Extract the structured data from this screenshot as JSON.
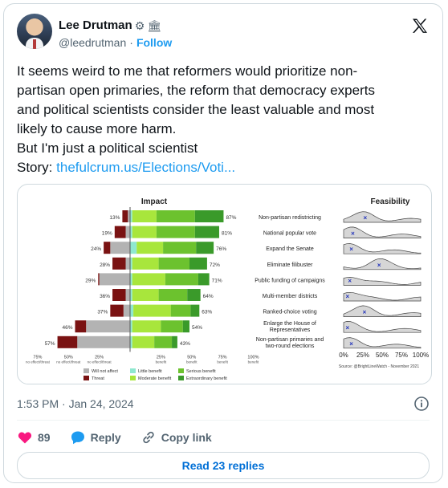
{
  "author": {
    "name": "Lee Drutman",
    "handle": "@leedrutman",
    "separator": "·",
    "follow_label": "Follow",
    "badge_icons": [
      "gear-icon",
      "government-icon"
    ]
  },
  "tweet": {
    "lines": [
      "It seems weird to me that reformers would prioritize non-",
      "partisan open primaries, the reform that democracy experts",
      "and political scientists consider the least valuable and most",
      "likely to cause more harm.",
      "But I'm just a political scientist"
    ],
    "story_label": "Story:",
    "story_link": "thefulcrum.us/Elections/Voti..."
  },
  "chart_data": {
    "type": "bar",
    "title_left": "Impact",
    "title_right": "Feasibility",
    "categories": [
      "Non-partisan redistricting",
      "National popular vote",
      "Expand the Senate",
      "Eliminate filibuster",
      "Public funding of campaigns",
      "Multi-member districts",
      "Ranked-choice voting",
      "Enlarge the House of Representatives",
      "Non-partisan primaries and two-round elections"
    ],
    "category_lines": [
      [
        "Non-partisan redistricting"
      ],
      [
        "National popular vote"
      ],
      [
        "Expand the Senate"
      ],
      [
        "Eliminate filibuster"
      ],
      [
        "Public funding of campaigns"
      ],
      [
        "Multi-member districts"
      ],
      [
        "Ranked-choice voting"
      ],
      [
        "Enlarge the House of",
        "Representatives"
      ],
      [
        "Non-partisan primaries and",
        "two-round elections"
      ]
    ],
    "negative_total_labels": [
      "13%",
      "19%",
      "24%",
      "28%",
      "29%",
      "36%",
      "37%",
      "46%",
      "57%"
    ],
    "positive_total_labels": [
      "87%",
      "81%",
      "76%",
      "72%",
      "71%",
      "64%",
      "63%",
      "54%",
      "43%"
    ],
    "series": [
      {
        "name": "Will not affect",
        "values": [
          2,
          4,
          18,
          4,
          28,
          4,
          6,
          40,
          48
        ]
      },
      {
        "name": "Threat",
        "values": [
          5,
          10,
          6,
          12,
          1,
          12,
          12,
          10,
          18
        ]
      },
      {
        "name": "Little benefit",
        "values": [
          2,
          2,
          6,
          2,
          2,
          2,
          3,
          2,
          2
        ]
      },
      {
        "name": "Moderate benefit",
        "values": [
          22,
          22,
          24,
          24,
          30,
          24,
          34,
          26,
          20
        ]
      },
      {
        "name": "Serious benefit",
        "values": [
          35,
          35,
          30,
          28,
          30,
          26,
          18,
          20,
          16
        ]
      },
      {
        "name": "Extraordinary benefit",
        "values": [
          26,
          22,
          16,
          16,
          10,
          12,
          8,
          6,
          5
        ]
      }
    ],
    "left_axis_ticks": [
      "75%",
      "50%",
      "25%"
    ],
    "left_axis_subticks": [
      "no effect/threat",
      "no effect/threat",
      "no effect/threat"
    ],
    "right_axis_ticks": [
      "25%",
      "50%",
      "75%",
      "100%"
    ],
    "right_axis_subticks": [
      "benefit",
      "benefit",
      "benefit",
      "benefit"
    ],
    "feasibility_ticks": [
      "0%",
      "25%",
      "50%",
      "75%",
      "100%"
    ],
    "feasibility_means": [
      0.28,
      0.12,
      0.1,
      0.46,
      0.08,
      0.05,
      0.27,
      0.05,
      0.1
    ],
    "source": "Source: @BrightLineWatch - November 2021",
    "colors": {
      "will_not_affect": "#b3b3b3",
      "threat": "#7a1212",
      "little_benefit": "#8fe8d0",
      "moderate_benefit": "#a8e63c",
      "serious_benefit": "#6cc22e",
      "extraordinary_benefit": "#3a9a2a"
    },
    "legend": [
      "Will not affect",
      "Threat",
      "Little benefit",
      "Moderate benefit",
      "Serious benefit",
      "Extraordinary benefit"
    ]
  },
  "meta": {
    "timestamp": "1:53 PM · Jan 24, 2024"
  },
  "actions": {
    "like_count": "89",
    "reply_label": "Reply",
    "copy_label": "Copy link"
  },
  "read_replies_label": "Read 23 replies",
  "colors": {
    "link": "#1d9bf0",
    "like": "#f91880",
    "reply": "#1d9bf0"
  }
}
